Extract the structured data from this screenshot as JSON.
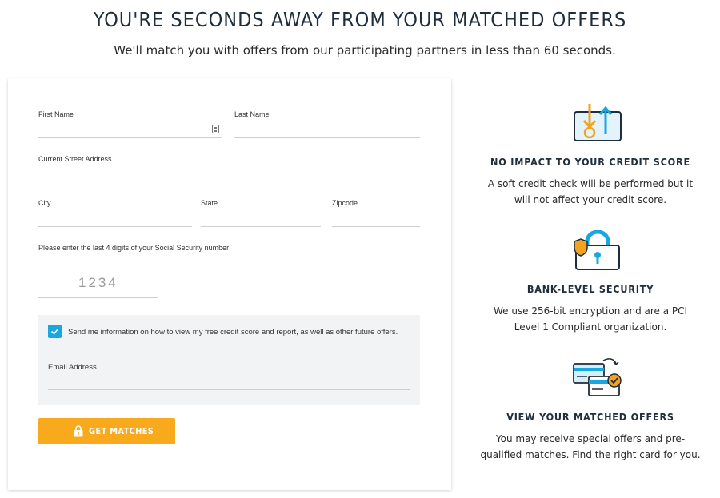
{
  "header": {
    "title": "YOU'RE SECONDS AWAY FROM YOUR MATCHED OFFERS",
    "subtitle": "We'll match you with offers from our participating partners in less than 60 seconds."
  },
  "form": {
    "first_name_label": "First Name",
    "last_name_label": "Last Name",
    "street_label": "Current Street Address",
    "city_label": "City",
    "state_label": "State",
    "zip_label": "Zipcode",
    "ssn_prompt": "Please enter the last 4 digits of your Social Security number",
    "ssn_placeholder": "1234",
    "consent_checked": true,
    "consent_text": "Send me information on how to view my free credit score and report, as well as other future offers.",
    "email_label": "Email Address",
    "submit_label": "GET MATCHES"
  },
  "features": [
    {
      "icon": "credit-check-icon",
      "title": "NO IMPACT TO YOUR CREDIT SCORE",
      "text": "A soft credit check will be performed but it will not affect your credit score."
    },
    {
      "icon": "padlock-shield-icon",
      "title": "BANK-LEVEL SECURITY",
      "text": "We use 256-bit encryption and are a PCI Level 1 Compliant organization."
    },
    {
      "icon": "credit-cards-check-icon",
      "title": "VIEW YOUR MATCHED OFFERS",
      "text": "You may receive special offers and pre-qualified matches. Find the right card for you."
    }
  ],
  "colors": {
    "accent": "#f9a91c",
    "checkbox": "#1aa7e0",
    "heading": "#1f2d3d",
    "icon_blue": "#1aa7e0",
    "icon_orange": "#f4a21c"
  }
}
